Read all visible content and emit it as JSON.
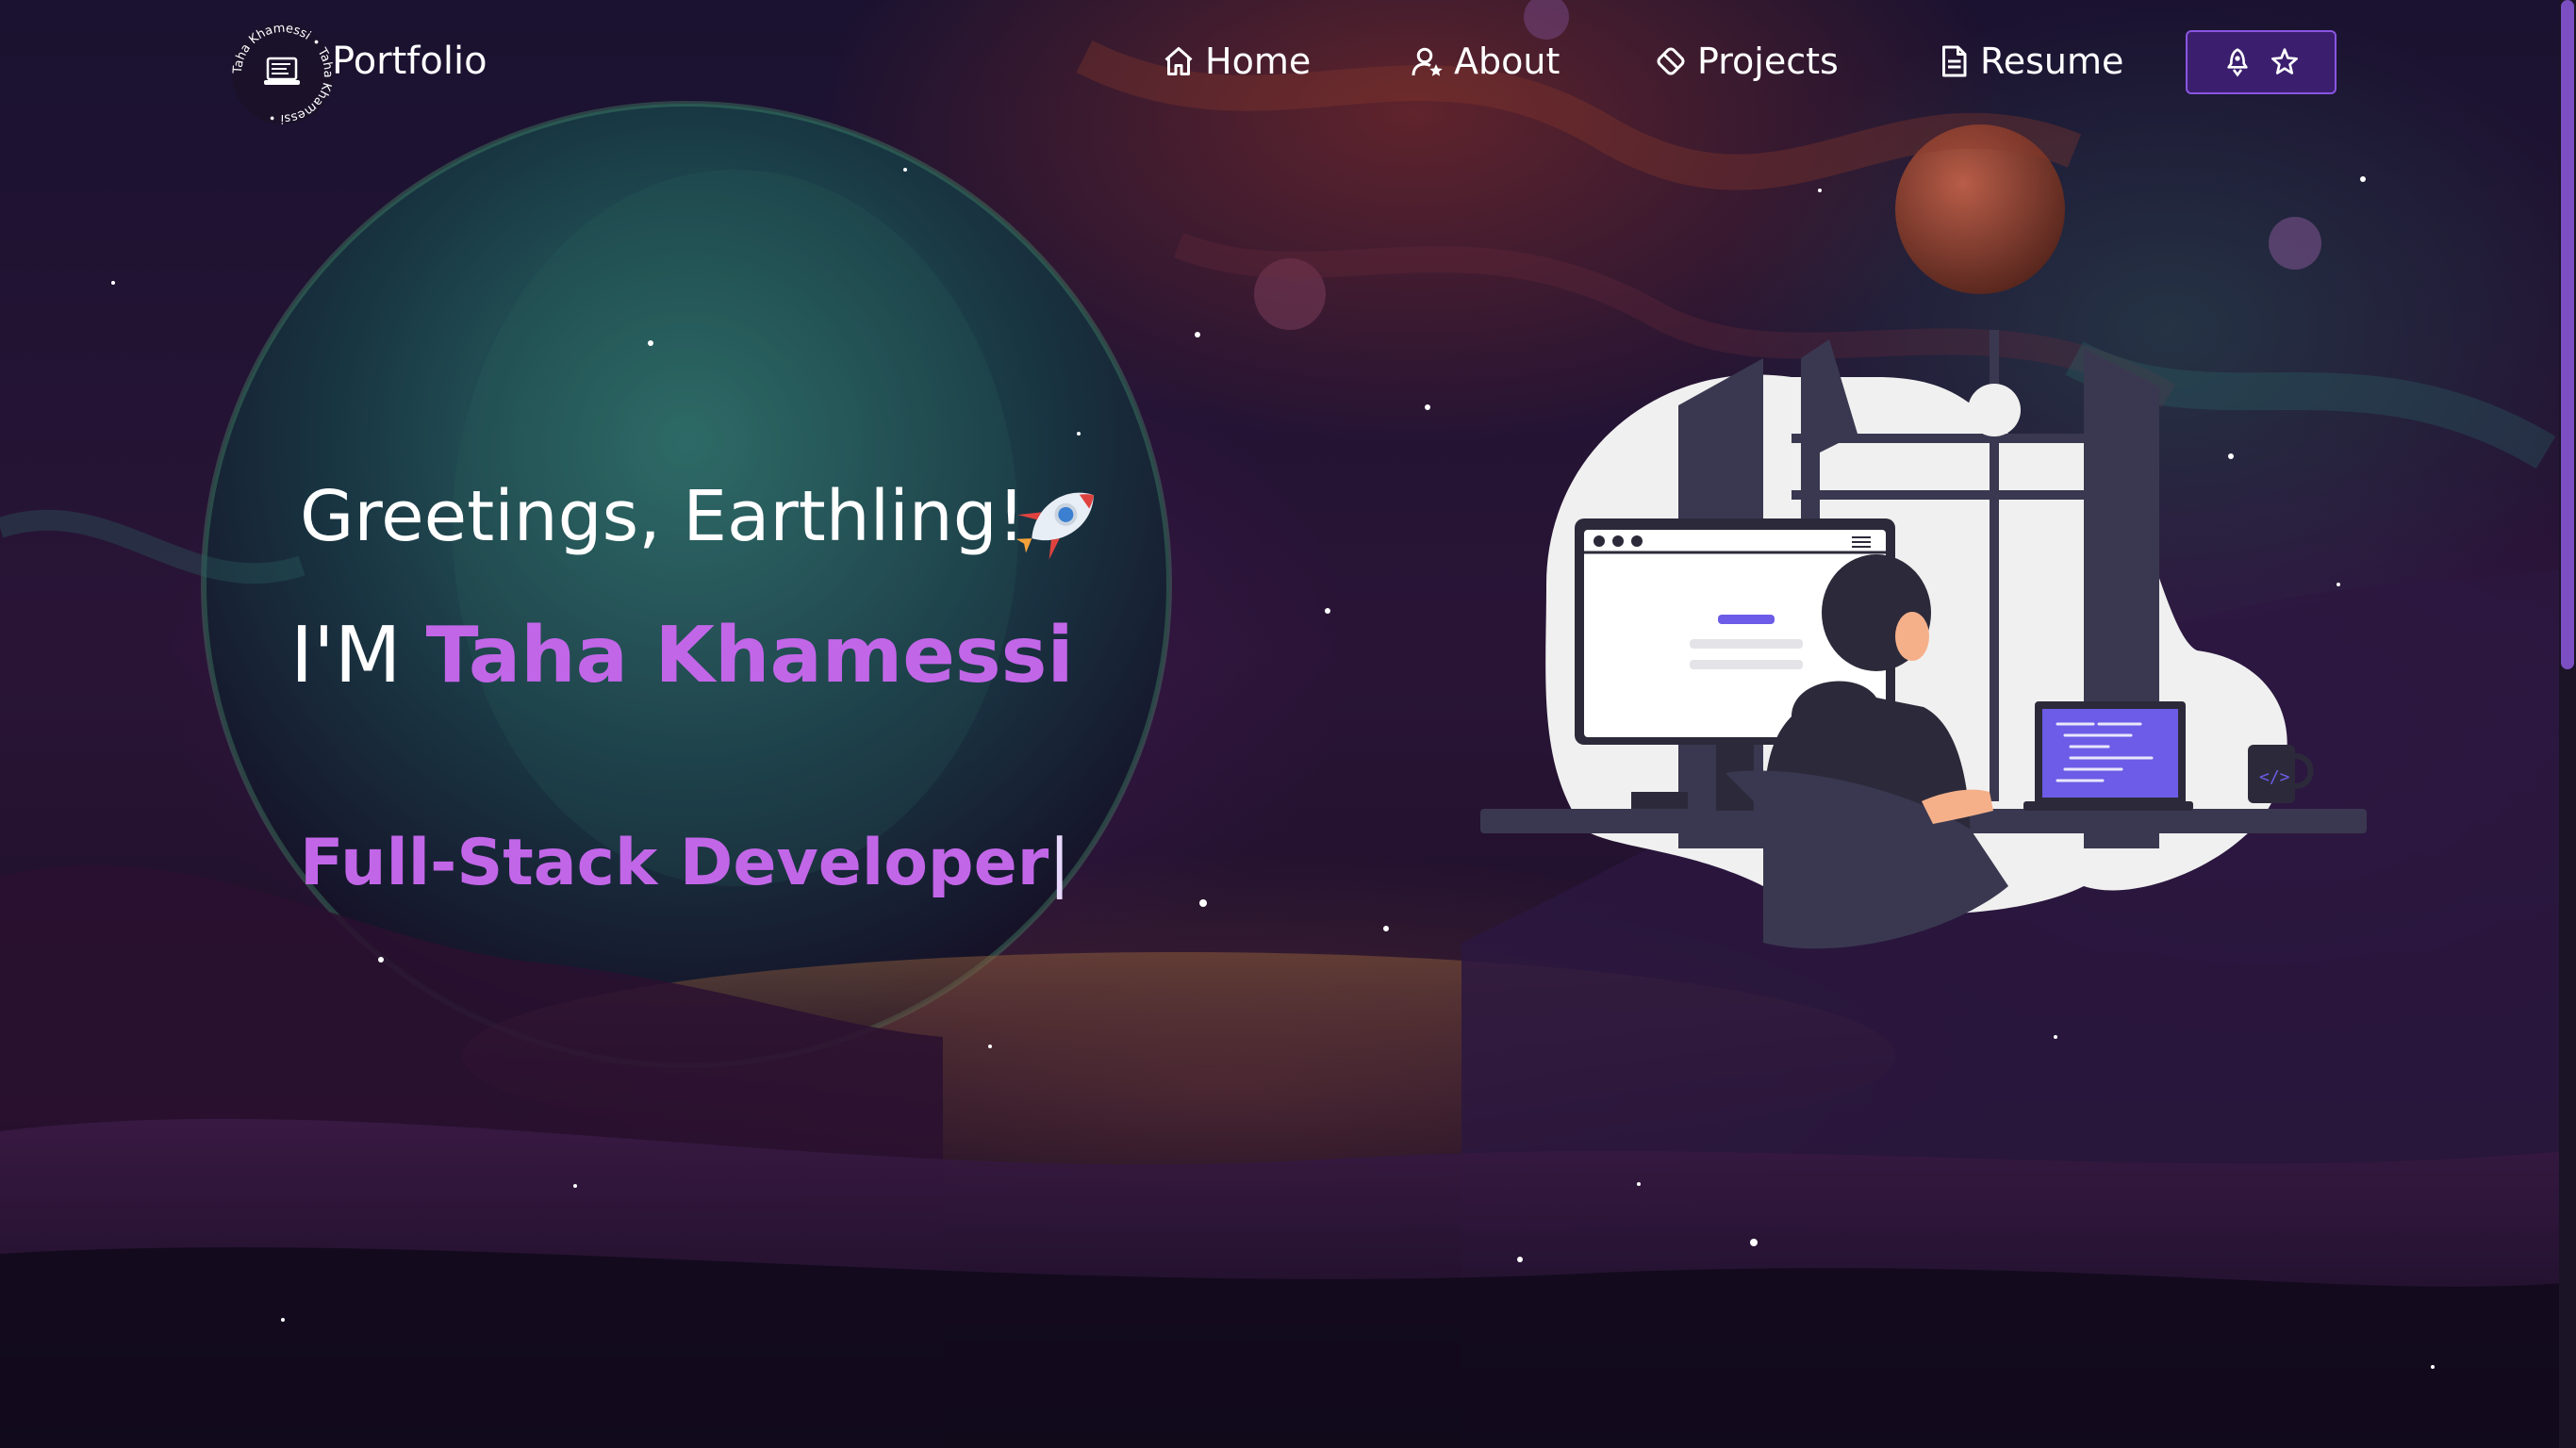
{
  "logo": {
    "ring_text": "Taha Khamessi • Taha Khamessi •",
    "brand": "Portfolio"
  },
  "nav": {
    "items": [
      {
        "label": "Home",
        "icon": "home-icon"
      },
      {
        "label": "About",
        "icon": "user-star-icon"
      },
      {
        "label": "Projects",
        "icon": "projects-icon"
      },
      {
        "label": "Resume",
        "icon": "document-icon"
      }
    ],
    "github_button": {
      "icons": [
        "git-fork-icon",
        "star-icon"
      ]
    }
  },
  "hero": {
    "greeting": "Greetings, Earthling!",
    "greeting_icon": "rocket-icon",
    "intro_prefix": "I'M",
    "name": "Taha Khamessi",
    "role": "Full-Stack Developer",
    "cursor": "|"
  },
  "colors": {
    "accent": "#c266e8",
    "button_bg": "#3b1f6e",
    "button_border": "#8a55e0",
    "text": "#ffffff"
  }
}
